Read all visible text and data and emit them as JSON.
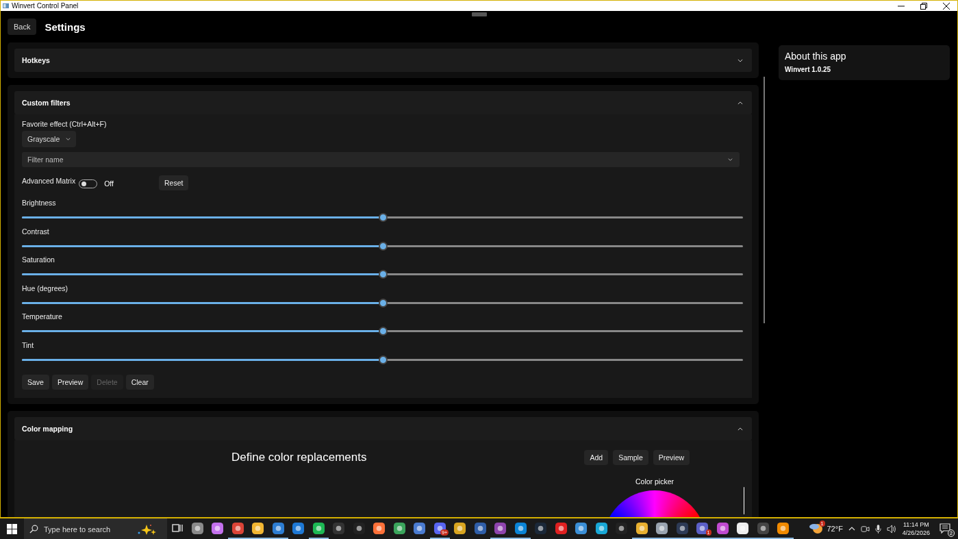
{
  "window": {
    "title": "Winvert Control Panel"
  },
  "header": {
    "back": "Back",
    "title": "Settings"
  },
  "sections": [
    {
      "kind": "hotkeys",
      "title": "Hotkeys",
      "expanded": false
    },
    {
      "kind": "filters",
      "title": "Custom filters",
      "expanded": true
    },
    {
      "kind": "mapping",
      "title": "Color mapping",
      "expanded": true
    }
  ],
  "custom_filters": {
    "favorite_label": "Favorite effect (Ctrl+Alt+F)",
    "favorite_value": "Grayscale",
    "filter_name": {
      "placeholder": "Filter name"
    },
    "advanced_matrix": {
      "label": "Advanced Matrix",
      "on": false,
      "state_text": "Off"
    },
    "reset": "Reset",
    "sliders": [
      {
        "label": "Brightness",
        "level": 0.5
      },
      {
        "label": "Contrast",
        "level": 0.5
      },
      {
        "label": "Saturation",
        "level": 0.5
      },
      {
        "label": "Hue (degrees)",
        "level": 0.5
      },
      {
        "label": "Temperature",
        "level": 0.5
      },
      {
        "label": "Tint",
        "level": 0.5
      }
    ],
    "buttons": [
      {
        "label": "Save",
        "disabled": false
      },
      {
        "label": "Preview",
        "disabled": false
      },
      {
        "label": "Delete",
        "disabled": true
      },
      {
        "label": "Clear",
        "disabled": false
      }
    ]
  },
  "color_mapping": {
    "heading": "Define color replacements",
    "buttons": [
      "Add",
      "Sample",
      "Preview"
    ],
    "picker_label": "Color picker"
  },
  "about": {
    "title": "About this app",
    "version": "Winvert 1.0.25"
  },
  "taskbar": {
    "search": {
      "placeholder": "Type here to search"
    },
    "apps": [
      {
        "running": false
      },
      {
        "running": false
      },
      {
        "running": true
      },
      {
        "running": true
      },
      {
        "running": true
      },
      {
        "running": false
      },
      {
        "running": true
      },
      {
        "running": false
      },
      {
        "running": false
      },
      {
        "running": false
      },
      {
        "running": false
      },
      {
        "running": false
      },
      {
        "running": true,
        "badge": "9+"
      },
      {
        "running": false
      },
      {
        "running": false
      },
      {
        "running": true
      },
      {
        "running": true
      },
      {
        "running": false
      },
      {
        "running": false
      },
      {
        "running": false
      },
      {
        "running": false
      },
      {
        "running": false
      },
      {
        "running": true
      },
      {
        "running": true
      },
      {
        "running": true
      },
      {
        "running": true,
        "badge": "1"
      },
      {
        "running": true
      },
      {
        "running": true
      },
      {
        "running": true
      },
      {
        "running": true
      }
    ],
    "weather": "72°F",
    "weather_badge": "1",
    "time": "11:14 PM",
    "date": "4/26/2026",
    "notifications": "2"
  }
}
